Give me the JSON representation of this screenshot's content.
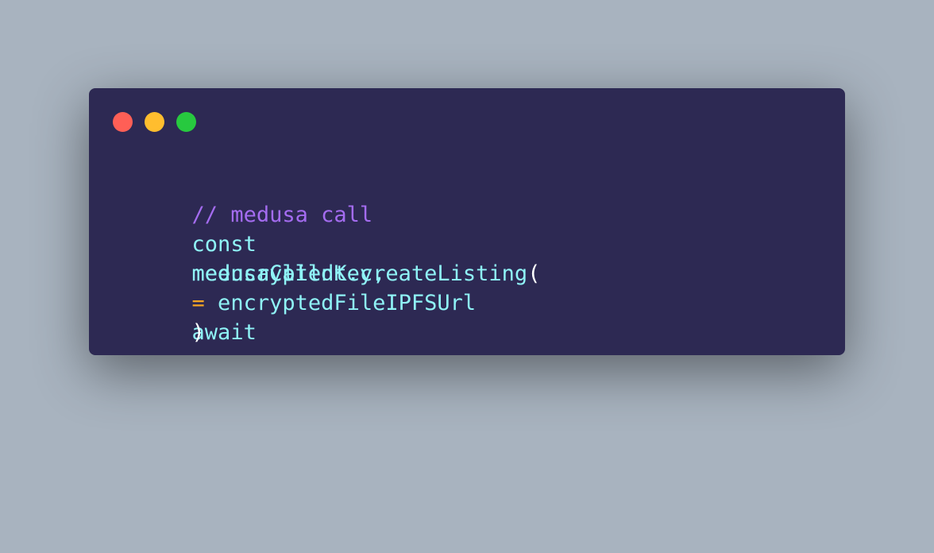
{
  "window": {
    "controls": {
      "close_color": "#ff5f56",
      "minimize_color": "#ffbd2e",
      "maximize_color": "#27c93f"
    }
  },
  "code": {
    "comment": "// medusa call",
    "line2": {
      "kw_const": "const",
      "var": "medusaCall",
      "op": "=",
      "kw_await": "await"
    },
    "line3_overlap_call": "medusaClient.createListing",
    "line3_overlap_paren": "(",
    "line3_arg1": "  encryptedKey,",
    "line4_arg2": "  encryptedFileIPFSUrl",
    "line5_close": ")"
  }
}
